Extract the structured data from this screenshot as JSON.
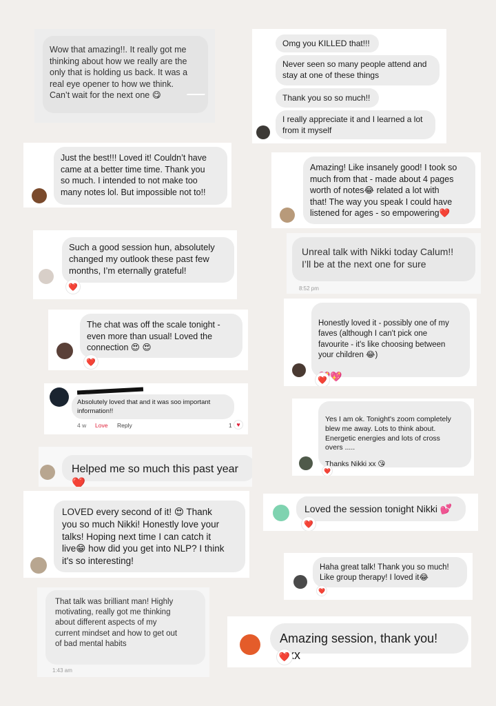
{
  "messages": {
    "m1": {
      "text": "Wow that amazing!!. It really got me\nthinking about how we really are the\nonly that is holding us back. It was a\nreal eye opener to how we think.\nCan’t wait for the next one 😋"
    },
    "m2": {
      "b1": "Omg you KILLED that!!!",
      "b2": "Never seen so many people attend and\nstay at one of these things",
      "b3": "Thank you so so much!!",
      "b4": "I really appreciate it and I learned a lot\nfrom it myself"
    },
    "m3": {
      "text": "Just the best!!! Loved it! Couldn’t have\ncame at a better time time. Thank you\nso much. I intended to not make too\nmany notes lol. But impossible not to!!"
    },
    "m4": {
      "text": "Amazing! Like insanely good! I took so\nmuch from that - made about 4 pages\nworth of notes😂 related a lot with\nthat! The way you speak I could have\nlistened for ages - so empowering❤️"
    },
    "m5": {
      "text": "Such a good session hun, absolutely\nchanged my outlook these past few\nmonths, I’m eternally grateful!",
      "reaction": "❤️"
    },
    "m6": {
      "text": "Unreal talk with Nikki today Calum!!\nI’ll be at the next one for sure",
      "time": "8:52 pm"
    },
    "m7": {
      "text": "The chat was off the scale tonight -\neven more than usual! Loved the\nconnection 😍 😍",
      "reaction": "❤️"
    },
    "m8": {
      "text": "Honestly loved it - possibly one of my\nfaves (although I can't pick one\nfavourite - it's like choosing between\nyour children 😂)",
      "emoji": "💖💖",
      "reaction": "❤️"
    },
    "m9": {
      "text": "Absolutely loved that and it was soo important\ninformation!!",
      "age": "4 w",
      "love": "Love",
      "reply": "Reply",
      "count": "1"
    },
    "m10": {
      "text": "Yes I am ok. Tonight's zoom completely\nblew me away. Lots to think about.\nEnergetic energies and lots of cross\novers .....",
      "sign": "Thanks Nikki xx 😘",
      "reaction": "❤️"
    },
    "m11": {
      "text": "Helped me so much this past year❤️"
    },
    "m12": {
      "text": "Loved the session tonight Nikki 💕",
      "reaction": "❤️"
    },
    "m13": {
      "text": "LOVED every second of it! 😍 Thank\nyou so much Nikki! Honestly love your\ntalks! Hoping next time I can catch it\nlive😁  how did you get into NLP? I think\nit's so interesting!"
    },
    "m14": {
      "text": "Haha great talk! Thank you so much!\nLike group therapy! I loved it😂",
      "reaction": "❤️"
    },
    "m15": {
      "text": "That talk was brilliant man! Highly\nmotivating, really got me thinking\nabout different aspects of my\ncurrent mindset and how to get out\nof bad mental habits",
      "time": "1:43 am"
    },
    "m16": {
      "text": "Amazing session, thank you! Xxx",
      "reaction": "❤️"
    }
  },
  "colors": {
    "background": "#f2efec",
    "bubble": "#ececec",
    "heart": "#e0213a",
    "love_link": "#e0213a"
  },
  "icons": [
    "avatar",
    "heart-reaction-icon",
    "reply-arrow-icon"
  ]
}
